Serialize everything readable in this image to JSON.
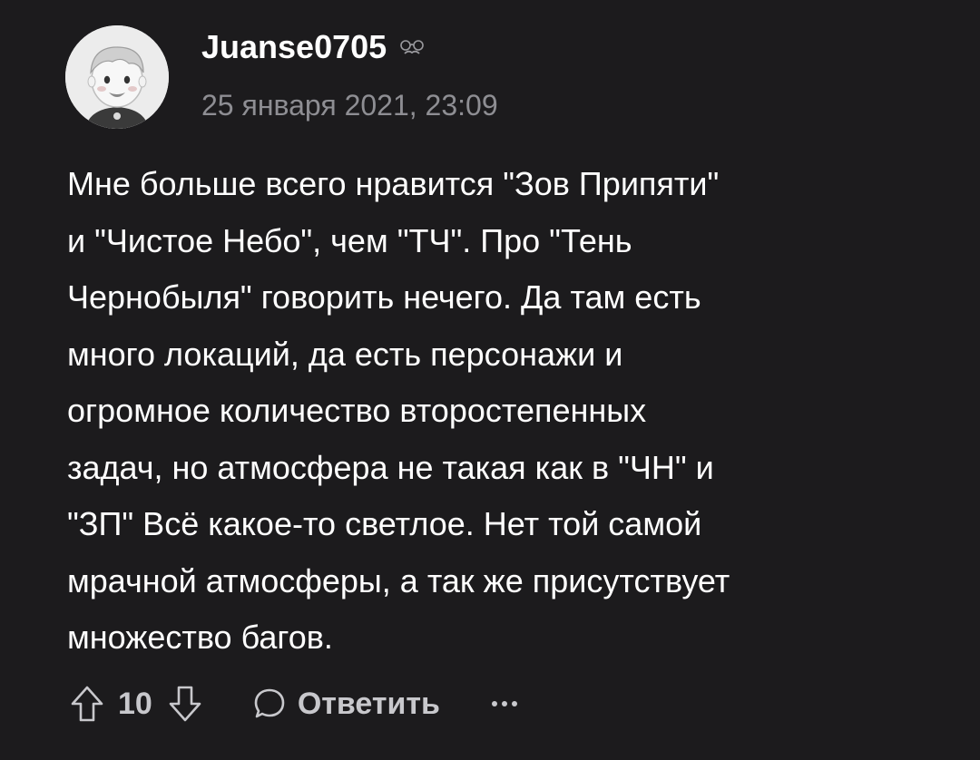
{
  "comment": {
    "author": "Juanse0705",
    "badge_icon": "glasses-mustache-icon",
    "timestamp": "25 января 2021, 23:09",
    "body_lines": [
      "Мне больше всего нравится \"Зов Припяти\"",
      "и \"Чистое Небо\", чем \"ТЧ\". Про \"Тень",
      "Чернобыля\" говорить нечего. Да там есть",
      "много локаций, да есть персонажи и",
      "огромное количество второстепенных",
      "задач, но атмосфера не такая как в \"ЧН\" и",
      "\"ЗП\" Всё какое-то светлое. Нет той самой",
      "мрачной атмосферы, а так же присутствует",
      "множество багов."
    ],
    "score": "10",
    "reply_label": "Ответить"
  },
  "icons": {
    "upvote": "arrow-up-icon",
    "downvote": "arrow-down-icon",
    "reply": "speech-bubble-icon",
    "more": "more-dots-icon"
  },
  "colors": {
    "background": "#1c1b1d",
    "text": "#ffffff",
    "muted": "#8e8e93",
    "action": "#c8c8cc"
  }
}
